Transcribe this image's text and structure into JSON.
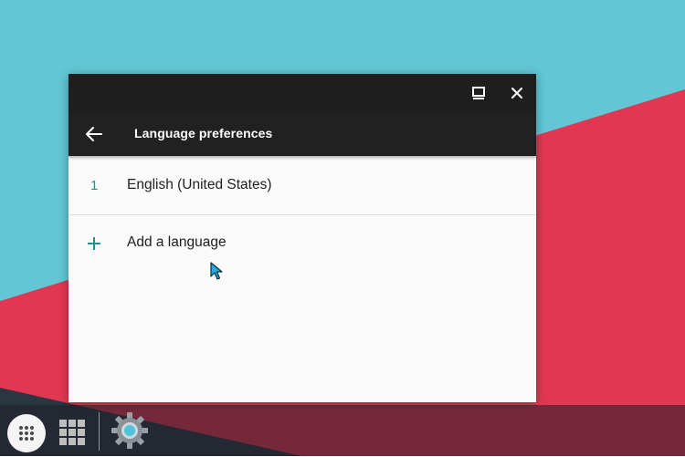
{
  "window": {
    "title": "Language preferences",
    "controls": {
      "maximize_icon": "maximize-icon",
      "close_icon": "close-icon"
    }
  },
  "languages": {
    "items": [
      {
        "index": "1",
        "label": "English (United States)"
      }
    ],
    "add_label": "Add a language",
    "add_icon": "plus-icon"
  },
  "shelf": {
    "items": [
      "launcher-icon",
      "apps-grid-icon",
      "settings-gear-icon"
    ]
  },
  "colors": {
    "wallpaper_cyan": "#62c6d4",
    "wallpaper_red": "#e23753",
    "titlebar": "#1e1e1e",
    "header": "#212121",
    "accent": "#159688",
    "surface": "#fafafa"
  }
}
